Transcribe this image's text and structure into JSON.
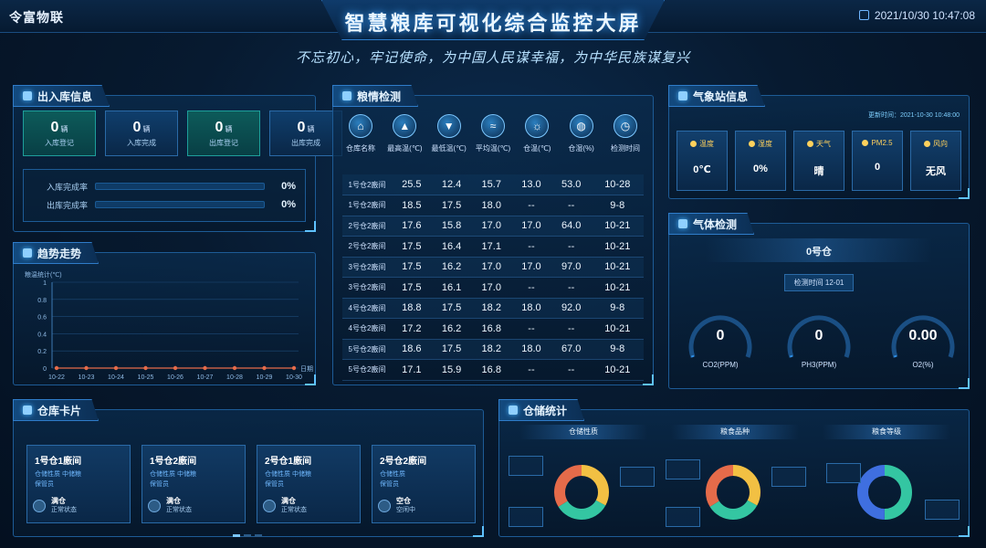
{
  "header": {
    "brand": "令富物联",
    "title": "智慧粮库可视化综合监控大屏",
    "slogan": "不忘初心，牢记使命，为中国人民谋幸福，为中华民族谋复兴",
    "datetime": "2021/10/30 10:47:08"
  },
  "inout": {
    "title": "出入库信息",
    "kpis": [
      {
        "value": "0",
        "unit": "辆",
        "label": "入库登记"
      },
      {
        "value": "0",
        "unit": "辆",
        "label": "入库完成"
      },
      {
        "value": "0",
        "unit": "辆",
        "label": "出库登记"
      },
      {
        "value": "0",
        "unit": "辆",
        "label": "出库完成"
      }
    ],
    "rates": [
      {
        "label": "入库完成率",
        "value": "0%",
        "pct": 0
      },
      {
        "label": "出库完成率",
        "value": "0%",
        "pct": 0
      }
    ]
  },
  "trend": {
    "title": "趋势走势"
  },
  "chart_data": {
    "type": "line",
    "ylabel": "粮温统计(℃)",
    "xlabel": "日期",
    "categories": [
      "10-22",
      "10-23",
      "10-24",
      "10-25",
      "10-26",
      "10-27",
      "10-28",
      "10-29",
      "10-30"
    ],
    "series": [
      {
        "values": [
          0,
          0,
          0,
          0,
          0,
          0,
          0,
          0,
          0
        ]
      }
    ],
    "ylim": [
      0,
      1
    ],
    "yticks": [
      "0",
      "0.2",
      "0.4",
      "0.6",
      "0.8",
      "1"
    ],
    "grid": true
  },
  "grain": {
    "title": "粮情检测",
    "columns": [
      {
        "icon": "warehouse-icon",
        "glyph": "⌂",
        "label": "仓库名称"
      },
      {
        "icon": "max-temp-icon",
        "glyph": "▲",
        "label": "最高温(℃)"
      },
      {
        "icon": "min-temp-icon",
        "glyph": "▼",
        "label": "最低温(℃)"
      },
      {
        "icon": "avg-temp-icon",
        "glyph": "≈",
        "label": "平均温(℃)"
      },
      {
        "icon": "room-temp-icon",
        "glyph": "☼",
        "label": "仓温(℃)"
      },
      {
        "icon": "humidity-icon",
        "glyph": "◍",
        "label": "仓湿(%)"
      },
      {
        "icon": "clock-icon",
        "glyph": "◷",
        "label": "检测时间"
      }
    ],
    "rows": [
      [
        "1号仓2廒间",
        "25.5",
        "12.4",
        "15.7",
        "13.0",
        "53.0",
        "10-28"
      ],
      [
        "1号仓2廒间",
        "18.5",
        "17.5",
        "18.0",
        "--",
        "--",
        "9-8"
      ],
      [
        "2号仓2廒间",
        "17.6",
        "15.8",
        "17.0",
        "17.0",
        "64.0",
        "10-21"
      ],
      [
        "2号仓2廒间",
        "17.5",
        "16.4",
        "17.1",
        "--",
        "--",
        "10-21"
      ],
      [
        "3号仓2廒间",
        "17.5",
        "16.2",
        "17.0",
        "17.0",
        "97.0",
        "10-21"
      ],
      [
        "3号仓2廒间",
        "17.5",
        "16.1",
        "17.0",
        "--",
        "--",
        "10-21"
      ],
      [
        "4号仓2廒间",
        "18.8",
        "17.5",
        "18.2",
        "18.0",
        "92.0",
        "9-8"
      ],
      [
        "4号仓2廒间",
        "17.2",
        "16.2",
        "16.8",
        "--",
        "--",
        "10-21"
      ],
      [
        "5号仓2廒间",
        "18.6",
        "17.5",
        "18.2",
        "18.0",
        "67.0",
        "9-8"
      ],
      [
        "5号仓2廒间",
        "17.1",
        "15.9",
        "16.8",
        "--",
        "--",
        "10-21"
      ]
    ]
  },
  "weather": {
    "title": "气象站信息",
    "date": "更新时间：2021-10-30 10:48:00",
    "items": [
      {
        "icon": "thermometer-icon",
        "label": "温度",
        "value": "0℃"
      },
      {
        "icon": "humidity-icon",
        "label": "湿度",
        "value": "0%"
      },
      {
        "icon": "sun-icon",
        "label": "天气",
        "value": "晴"
      },
      {
        "icon": "dust-icon",
        "label": "PM2.5",
        "value": "0"
      },
      {
        "icon": "wind-icon",
        "label": "风向",
        "value": "无风"
      }
    ]
  },
  "gas": {
    "title": "气体检测",
    "warehouse": "0号仓",
    "time": "检测时间 12-01",
    "gauges": [
      {
        "value": "0",
        "label": "CO2(PPM)",
        "pct": 0
      },
      {
        "value": "0",
        "label": "PH3(PPM)",
        "pct": 0
      },
      {
        "value": "0.00",
        "label": "O2(%)",
        "pct": 0
      }
    ]
  },
  "cards": {
    "title": "仓库卡片",
    "items": [
      {
        "name": "1号仓1廒间",
        "line1": "仓储性质  中储粮",
        "line2": "保管员",
        "status": "满仓",
        "sub": "正常状态"
      },
      {
        "name": "1号仓2廒间",
        "line1": "仓储性质  中储粮",
        "line2": "保管员",
        "status": "满仓",
        "sub": "正常状态"
      },
      {
        "name": "2号仓1廒间",
        "line1": "仓储性质  中储粮",
        "line2": "保管员",
        "status": "满仓",
        "sub": "正常状态"
      },
      {
        "name": "2号仓2廒间",
        "line1": "仓储性质",
        "line2": "保管员",
        "status": "空仓",
        "sub": "空闲中"
      }
    ]
  },
  "storage": {
    "title": "仓储统计",
    "groups": [
      {
        "label": "仓储性质"
      },
      {
        "label": "粮食品种"
      },
      {
        "label": "粮食等级"
      }
    ]
  },
  "colors": {
    "accent": "#3ba6ff",
    "yellow": "#f2c043",
    "teal": "#34c6a2",
    "red": "#e56b4a",
    "blue": "#3f6fe0"
  }
}
